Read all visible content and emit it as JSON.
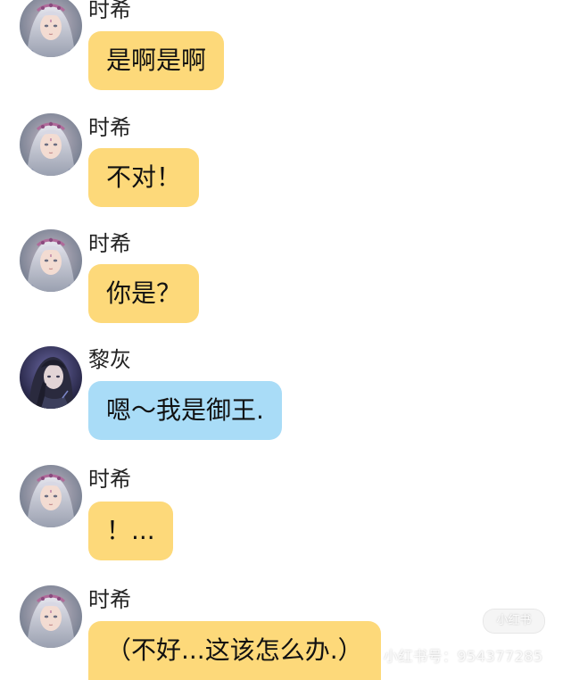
{
  "messages": [
    {
      "sender": "时希",
      "text": "是啊是啊",
      "color": "#FDD97A"
    },
    {
      "sender": "时希",
      "text": "不对！",
      "color": "#FDD97A"
    },
    {
      "sender": "时希",
      "text": "你是？",
      "color": "#FDD97A"
    },
    {
      "sender": "黎灰",
      "text": "嗯～我是御王.",
      "color": "#A9DCF7"
    },
    {
      "sender": "时希",
      "text": "！...",
      "color": "#FDD97A"
    },
    {
      "sender": "时希",
      "text": "（不好...这该怎么办.）",
      "color": "#FDD97A"
    }
  ],
  "avatars": {
    "shixi": {
      "icon": "silver-hair-girl-avatar-icon"
    },
    "lihui": {
      "icon": "dark-hair-man-avatar-icon"
    }
  },
  "watermark": {
    "text": "小红书号：954377285",
    "logo": "小红书"
  }
}
